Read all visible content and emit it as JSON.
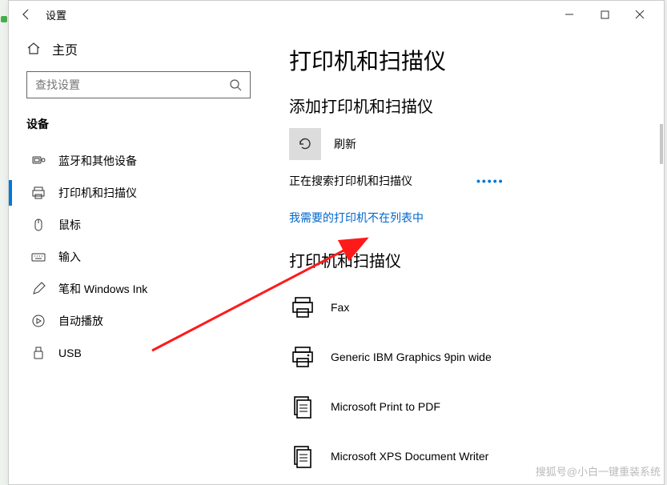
{
  "titlebar": {
    "title": "设置"
  },
  "sidebar": {
    "home": "主页",
    "search_placeholder": "查找设置",
    "section": "设备",
    "items": [
      {
        "label": "蓝牙和其他设备"
      },
      {
        "label": "打印机和扫描仪"
      },
      {
        "label": "鼠标"
      },
      {
        "label": "输入"
      },
      {
        "label": "笔和 Windows Ink"
      },
      {
        "label": "自动播放"
      },
      {
        "label": "USB"
      }
    ]
  },
  "main": {
    "title": "打印机和扫描仪",
    "add_heading": "添加打印机和扫描仪",
    "refresh": "刷新",
    "searching": "正在搜索打印机和扫描仪",
    "not_listed_link": "我需要的打印机不在列表中",
    "list_heading": "打印机和扫描仪",
    "devices": [
      {
        "name": "Fax"
      },
      {
        "name": "Generic IBM Graphics 9pin wide"
      },
      {
        "name": "Microsoft Print to PDF"
      },
      {
        "name": "Microsoft XPS Document Writer"
      }
    ]
  },
  "watermark": "搜狐号@小白一键重装系统"
}
